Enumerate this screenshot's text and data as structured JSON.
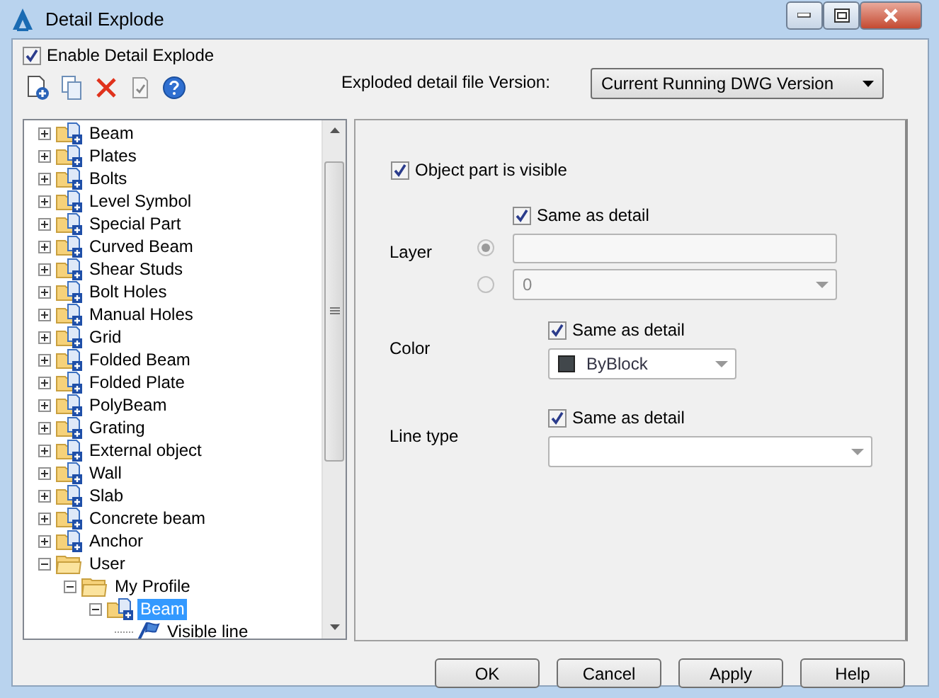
{
  "window": {
    "title": "Detail Explode"
  },
  "enable_explode": {
    "label": "Enable Detail Explode",
    "checked": true
  },
  "version": {
    "label": "Exploded detail file Version:",
    "value": "Current Running DWG Version"
  },
  "tree": [
    {
      "children": [
        {
          "label": "Beam",
          "kind": "part",
          "expanded": false,
          "selected": false
        },
        {
          "label": "Plates",
          "kind": "part",
          "expanded": false,
          "selected": false
        },
        {
          "label": "Bolts",
          "kind": "part",
          "expanded": false,
          "selected": false
        },
        {
          "label": "Level Symbol",
          "kind": "part",
          "expanded": false,
          "selected": false
        },
        {
          "label": "Special Part",
          "kind": "part",
          "expanded": false,
          "selected": false
        },
        {
          "label": "Curved Beam",
          "kind": "part",
          "expanded": false,
          "selected": false
        },
        {
          "label": "Shear Studs",
          "kind": "part",
          "expanded": false,
          "selected": false
        },
        {
          "label": "Bolt Holes",
          "kind": "part",
          "expanded": false,
          "selected": false
        },
        {
          "label": "Manual Holes",
          "kind": "part",
          "expanded": false,
          "selected": false
        },
        {
          "label": "Grid",
          "kind": "part",
          "expanded": false,
          "selected": false
        },
        {
          "label": "Folded Beam",
          "kind": "part",
          "expanded": false,
          "selected": false
        },
        {
          "label": "Folded Plate",
          "kind": "part",
          "expanded": false,
          "selected": false
        },
        {
          "label": "PolyBeam",
          "kind": "part",
          "expanded": false,
          "selected": false
        },
        {
          "label": "Grating",
          "kind": "part",
          "expanded": false,
          "selected": false
        },
        {
          "label": "External object",
          "kind": "part",
          "expanded": false,
          "selected": false
        },
        {
          "label": "Wall",
          "kind": "part",
          "expanded": false,
          "selected": false
        },
        {
          "label": "Slab",
          "kind": "part",
          "expanded": false,
          "selected": false
        },
        {
          "label": "Concrete beam",
          "kind": "part",
          "expanded": false,
          "selected": false
        },
        {
          "label": "Anchor",
          "kind": "part",
          "expanded": false,
          "selected": false
        }
      ]
    },
    {
      "label": "User",
      "kind": "folder",
      "expanded": true,
      "selected": false,
      "children": [
        {
          "label": "My Profile",
          "kind": "folder",
          "expanded": true,
          "selected": false,
          "children": [
            {
              "label": "Beam",
              "kind": "part",
              "expanded": true,
              "selected": true,
              "children": [
                {
                  "label": "Visible line",
                  "kind": "line",
                  "selected": false
                }
              ]
            }
          ]
        }
      ]
    }
  ],
  "panel": {
    "visible": {
      "label": "Object part is visible",
      "checked": true
    },
    "layer": {
      "label": "Layer",
      "disabled": true,
      "same_as_detail": {
        "label": "Same as detail",
        "checked": true
      },
      "options": [
        {
          "kind": "text",
          "selected": true
        },
        {
          "kind": "dropdown",
          "value": "0",
          "selected": false
        }
      ]
    },
    "color": {
      "label": "Color",
      "same_as_detail": {
        "label": "Same as detail",
        "checked": true
      },
      "value": "ByBlock",
      "color": "#41474b"
    },
    "line_type": {
      "label": "Line type",
      "same_as_detail": {
        "label": "Same as detail",
        "checked": true
      }
    }
  },
  "buttons": [
    "OK",
    "Cancel",
    "Apply",
    "Help"
  ]
}
